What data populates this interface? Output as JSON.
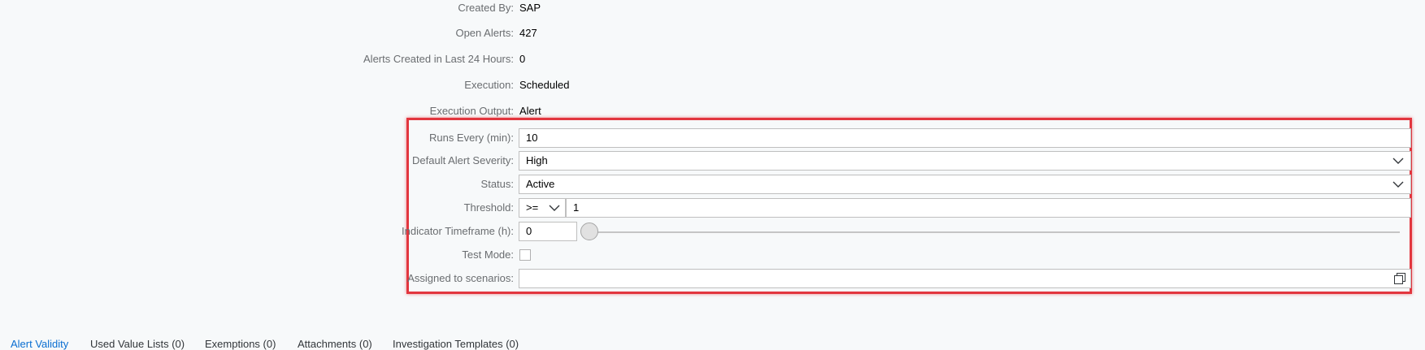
{
  "info": {
    "created_by_label": "Created By:",
    "created_by_value": "SAP",
    "open_alerts_label": "Open Alerts:",
    "open_alerts_value": "427",
    "alerts_24h_label": "Alerts Created in Last 24 Hours:",
    "alerts_24h_value": "0",
    "execution_label": "Execution:",
    "execution_value": "Scheduled",
    "execution_output_label": "Execution Output:",
    "execution_output_value": "Alert"
  },
  "form": {
    "runs_every_label": "Runs Every (min):",
    "runs_every_value": "10",
    "severity_label": "Default Alert Severity:",
    "severity_value": "High",
    "status_label": "Status:",
    "status_value": "Active",
    "threshold_label": "Threshold:",
    "threshold_operator": ">=",
    "threshold_value": "1",
    "timeframe_label": "Indicator Timeframe (h):",
    "timeframe_value": "0",
    "timeframe_slider_level": 0,
    "test_mode_label": "Test Mode:",
    "test_mode_checked": false,
    "scenarios_label": "Assigned to scenarios:",
    "scenarios_value": ""
  },
  "tabs": [
    {
      "label": "Alert Validity",
      "active": true
    },
    {
      "label": "Used Value Lists (0)",
      "active": false
    },
    {
      "label": "Exemptions (0)",
      "active": false
    },
    {
      "label": "Attachments (0)",
      "active": false
    },
    {
      "label": "Investigation Templates (0)",
      "active": false
    }
  ],
  "colors": {
    "highlight": "#e2363e",
    "active_tab": "#0a6ed1",
    "label": "#6a6d70"
  },
  "icons": {
    "dropdown": "chevron-down-icon",
    "value_help": "value-help-icon"
  }
}
